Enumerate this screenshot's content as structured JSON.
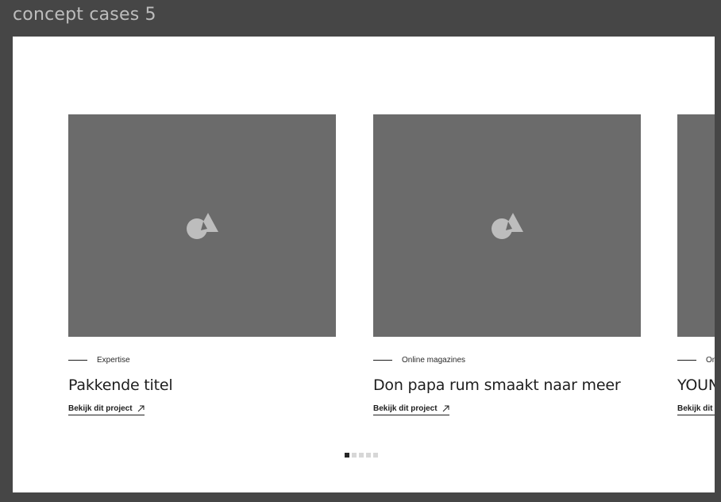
{
  "frame": {
    "title": "concept cases 5"
  },
  "cards": [
    {
      "category": "Expertise",
      "title": "Pakkende titel",
      "link": "Bekijk dit project"
    },
    {
      "category": "Online magazines",
      "title": "Don papa rum smaakt naar meer",
      "link": "Bekijk dit project"
    },
    {
      "category": "Online magazines",
      "title": "YOUNG online",
      "link": "Bekijk dit project"
    }
  ],
  "pager": {
    "count": 5,
    "active_index": 0
  },
  "colors": {
    "placeholder": "#6b6b6b",
    "text": "#1e1e1e",
    "dot_active": "#262626",
    "dot_inactive": "#d7d7d7"
  },
  "icons": {
    "thumbnail": "image-placeholder-icon",
    "link": "arrow-up-right-icon"
  }
}
